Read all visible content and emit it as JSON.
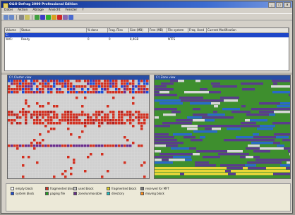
{
  "window": {
    "title": "O&O Defrag 2000 Professional Edition"
  },
  "menu": [
    "Datei",
    "Aktion",
    "Ablage",
    "Ansicht",
    "Fenster",
    "?"
  ],
  "toolbar": {
    "icons": [
      "back-icon",
      "forward-icon",
      "stop-icon",
      "properties-icon",
      "refresh-icon",
      "search-icon",
      "start-icon",
      "pause-icon",
      "stop-red-icon",
      "settings-icon",
      "help-icon"
    ]
  },
  "volumes": {
    "headers": [
      "Volume",
      "Status",
      "% done",
      "Frag. Files",
      "Size (MB)",
      "Free (MB)",
      "File system",
      "Freq. Used",
      "Current Modification"
    ],
    "rows": [
      {
        "volume": "C:",
        "status": "",
        "done": "",
        "frag": "",
        "size": "",
        "free": "",
        "fs": "",
        "freq": "",
        "mod": ""
      },
      {
        "volume": "Wd1:",
        "status": "Ready",
        "done": "0",
        "frag": "0",
        "size": "8,4GB",
        "free": "",
        "fs": "NTFS",
        "freq": "",
        "mod": ""
      }
    ]
  },
  "panes": {
    "left": {
      "title": "C:\\ Cluster view"
    },
    "right": {
      "title": "C:\\ Zone view"
    }
  },
  "legend": [
    {
      "label": "empty block",
      "color": "#ffffff"
    },
    {
      "label": "system block",
      "color": "#1e4ed6"
    },
    {
      "label": "fragmented block",
      "color": "#d23020"
    },
    {
      "label": "paging file",
      "color": "#20a020"
    },
    {
      "label": "used block",
      "color": "#c8c8c8"
    },
    {
      "label": "zone/unmovable",
      "color": "#6a2c8c"
    },
    {
      "label": "fragmented block",
      "color": "#e0d020"
    },
    {
      "label": "directory",
      "color": "#20c0c0"
    },
    {
      "label": "reserved for MFT",
      "color": "#7a7a7a"
    },
    {
      "label": "moving block",
      "color": "#ff8c1a"
    }
  ],
  "colors": {
    "blocks_used": "#c8c8c8",
    "blocks_frag": "#d23020",
    "zone_bg": "#3e8f2e",
    "zone_purple": "#5a3c8c",
    "zone_yellow": "#e8d638",
    "selection": "#1e46c8"
  }
}
